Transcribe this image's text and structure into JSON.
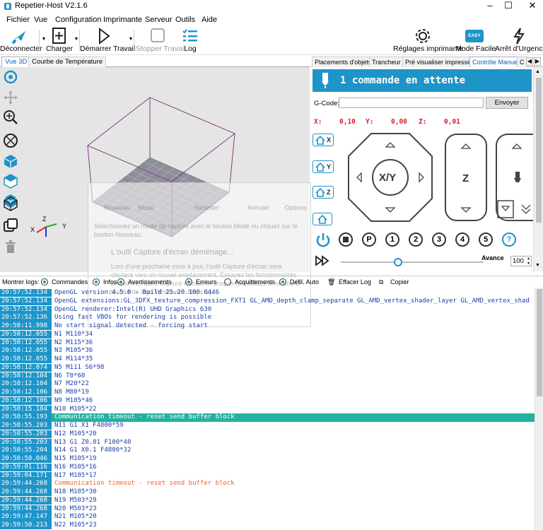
{
  "window": {
    "title": "Repetier-Host V2.1.6"
  },
  "menu": [
    "Fichier",
    "Vue",
    "Configuration",
    "Imprimante",
    "Serveur",
    "Outils",
    "Aide"
  ],
  "toolbar": {
    "disconnect": "Déconnecter",
    "load": "Charger",
    "start_job": "Démarrer Travail",
    "stop_job": "Stopper Travail",
    "log": "Log",
    "printer_settings": "Réglages imprimante",
    "easy_mode": "Mode Facile",
    "easy_badge": "EASY",
    "emergency_stop": "Arrêt d'Urgence"
  },
  "left_tabs": [
    "Vue 3D",
    "Courbe de Température"
  ],
  "right_tabs": [
    "Placements d'objets",
    "Trancheur",
    "Pré visualiser impression",
    "Contrôle Manuel",
    "C"
  ],
  "control": {
    "pending": "1 commande en attente",
    "gcode_label": "G-Code:",
    "send": "Envoyer",
    "x_label": "X:",
    "x_value": "0,10",
    "y_label": "Y:",
    "y_value": "0,00",
    "z_label": "Z:",
    "z_value": "0,01",
    "home_x": "X",
    "home_y": "Y",
    "home_z": "Z",
    "xy_label": "X/Y",
    "z_jog_label": "Z",
    "btn_p": "P",
    "btn_1": "1",
    "btn_2": "2",
    "btn_3": "3",
    "btn_4": "4",
    "btn_5": "5",
    "btn_help": "?",
    "advance_label": "Avance",
    "advance_value": "100",
    "advance_level": 0.4
  },
  "ghost": {
    "t1": "Nouveau",
    "t2": "Mode",
    "t3": "Retarder",
    "t4": "Annuler",
    "t5": "Options",
    "t6": "Sélectionnez un mode de capture avec le bouton Mode ou cliquez sur le bouton Nouveau.",
    "t7": "L'outil Capture d'écran déménage...",
    "t8": "Lors d'une prochaine mise à jour, l'outil Capture d'écran sera déplacé vers un nouvel emplacement. Essayez les fonctionnalités améliorées dans Capture d'écran et croquis (ou utilisez le raccourci touche de logo Windows + Maj + S)."
  },
  "logbar": {
    "show_logs": "Montrer logs:",
    "commands": "Commandes",
    "infos": "Infos",
    "warnings": "Avertissements",
    "errors": "Erreurs",
    "acks": "Acquittements",
    "autoscroll": "Défil. Auto",
    "clear": "Effacer Log",
    "copy": "Copier"
  },
  "log": [
    {
      "ts": "20:57:52.134",
      "msg": "OpenGL version:4.5.0 - Build 25.20.100.6446",
      "type": "info"
    },
    {
      "ts": "20:57:52.134",
      "msg": "OpenGL extensions:GL_3DFX_texture_compression_FXT1 GL_AMD_depth_clamp_separate GL_AMD_vertex_shader_layer GL_AMD_vertex_shad",
      "type": "info"
    },
    {
      "ts": "20:57:52.134",
      "msg": "OpenGL renderer:Intel(R) UHD Graphics 630",
      "type": "info"
    },
    {
      "ts": "20:57:52.136",
      "msg": "Using fast VBOs for rendering is possible",
      "type": "info"
    },
    {
      "ts": "20:58:11.998",
      "msg": "No start signal detected - forcing start",
      "type": "info"
    },
    {
      "ts": "20:58:12.055",
      "msg": "N1 M110*34",
      "type": "cmd"
    },
    {
      "ts": "20:58:12.055",
      "msg": "N2 M115*36",
      "type": "cmd"
    },
    {
      "ts": "20:58:12.055",
      "msg": "N3 M105*36",
      "type": "cmd"
    },
    {
      "ts": "20:58:12.055",
      "msg": "N4 M114*35",
      "type": "cmd"
    },
    {
      "ts": "20:58:12.074",
      "msg": "N5 M111 S6*98",
      "type": "cmd"
    },
    {
      "ts": "20:58:12.104",
      "msg": "N6 T0*60",
      "type": "cmd"
    },
    {
      "ts": "20:58:12.104",
      "msg": "N7 M20*22",
      "type": "cmd"
    },
    {
      "ts": "20:58:12.106",
      "msg": "N8 M80*19",
      "type": "cmd"
    },
    {
      "ts": "20:58:12.106",
      "msg": "N9 M105*46",
      "type": "cmd"
    },
    {
      "ts": "20:58:15.184",
      "msg": "N10 M105*22",
      "type": "cmd"
    },
    {
      "ts": "20:58:55.193",
      "msg": "Communication timeout - reset send buffer block",
      "type": "highlight"
    },
    {
      "ts": "20:58:55.203",
      "msg": "N11 G1 X1 F4800*59",
      "type": "cmd"
    },
    {
      "ts": "20:58:55.203",
      "msg": "N12 M105*20",
      "type": "cmd"
    },
    {
      "ts": "20:58:55.203",
      "msg": "N13 G1 Z0.01 F100*40",
      "type": "cmd"
    },
    {
      "ts": "20:58:55.204",
      "msg": "N14 G1 X0.1 F4800*32",
      "type": "cmd"
    },
    {
      "ts": "20:58:58.046",
      "msg": "N15 M105*19",
      "type": "cmd"
    },
    {
      "ts": "20:59:01.116",
      "msg": "N16 M105*16",
      "type": "cmd"
    },
    {
      "ts": "20:59:04.171",
      "msg": "N17 M105*17",
      "type": "cmd"
    },
    {
      "ts": "20:59:44.268",
      "msg": "Communication timeout - reset send buffer block",
      "type": "warn"
    },
    {
      "ts": "20:59:44.268",
      "msg": "N18 M105*30",
      "type": "cmd"
    },
    {
      "ts": "20:59:44.268",
      "msg": "N19 M503*29",
      "type": "cmd"
    },
    {
      "ts": "20:59:44.268",
      "msg": "N20 M503*23",
      "type": "cmd"
    },
    {
      "ts": "20:59:47.147",
      "msg": "N21 M105*20",
      "type": "cmd"
    },
    {
      "ts": "20:59:50.213",
      "msg": "N22 M105*23",
      "type": "cmd"
    }
  ],
  "colors": {
    "accent": "#1e95c8",
    "coord_red": "#d8202a",
    "highlight": "#25b1a0",
    "warn": "#e8652c"
  }
}
